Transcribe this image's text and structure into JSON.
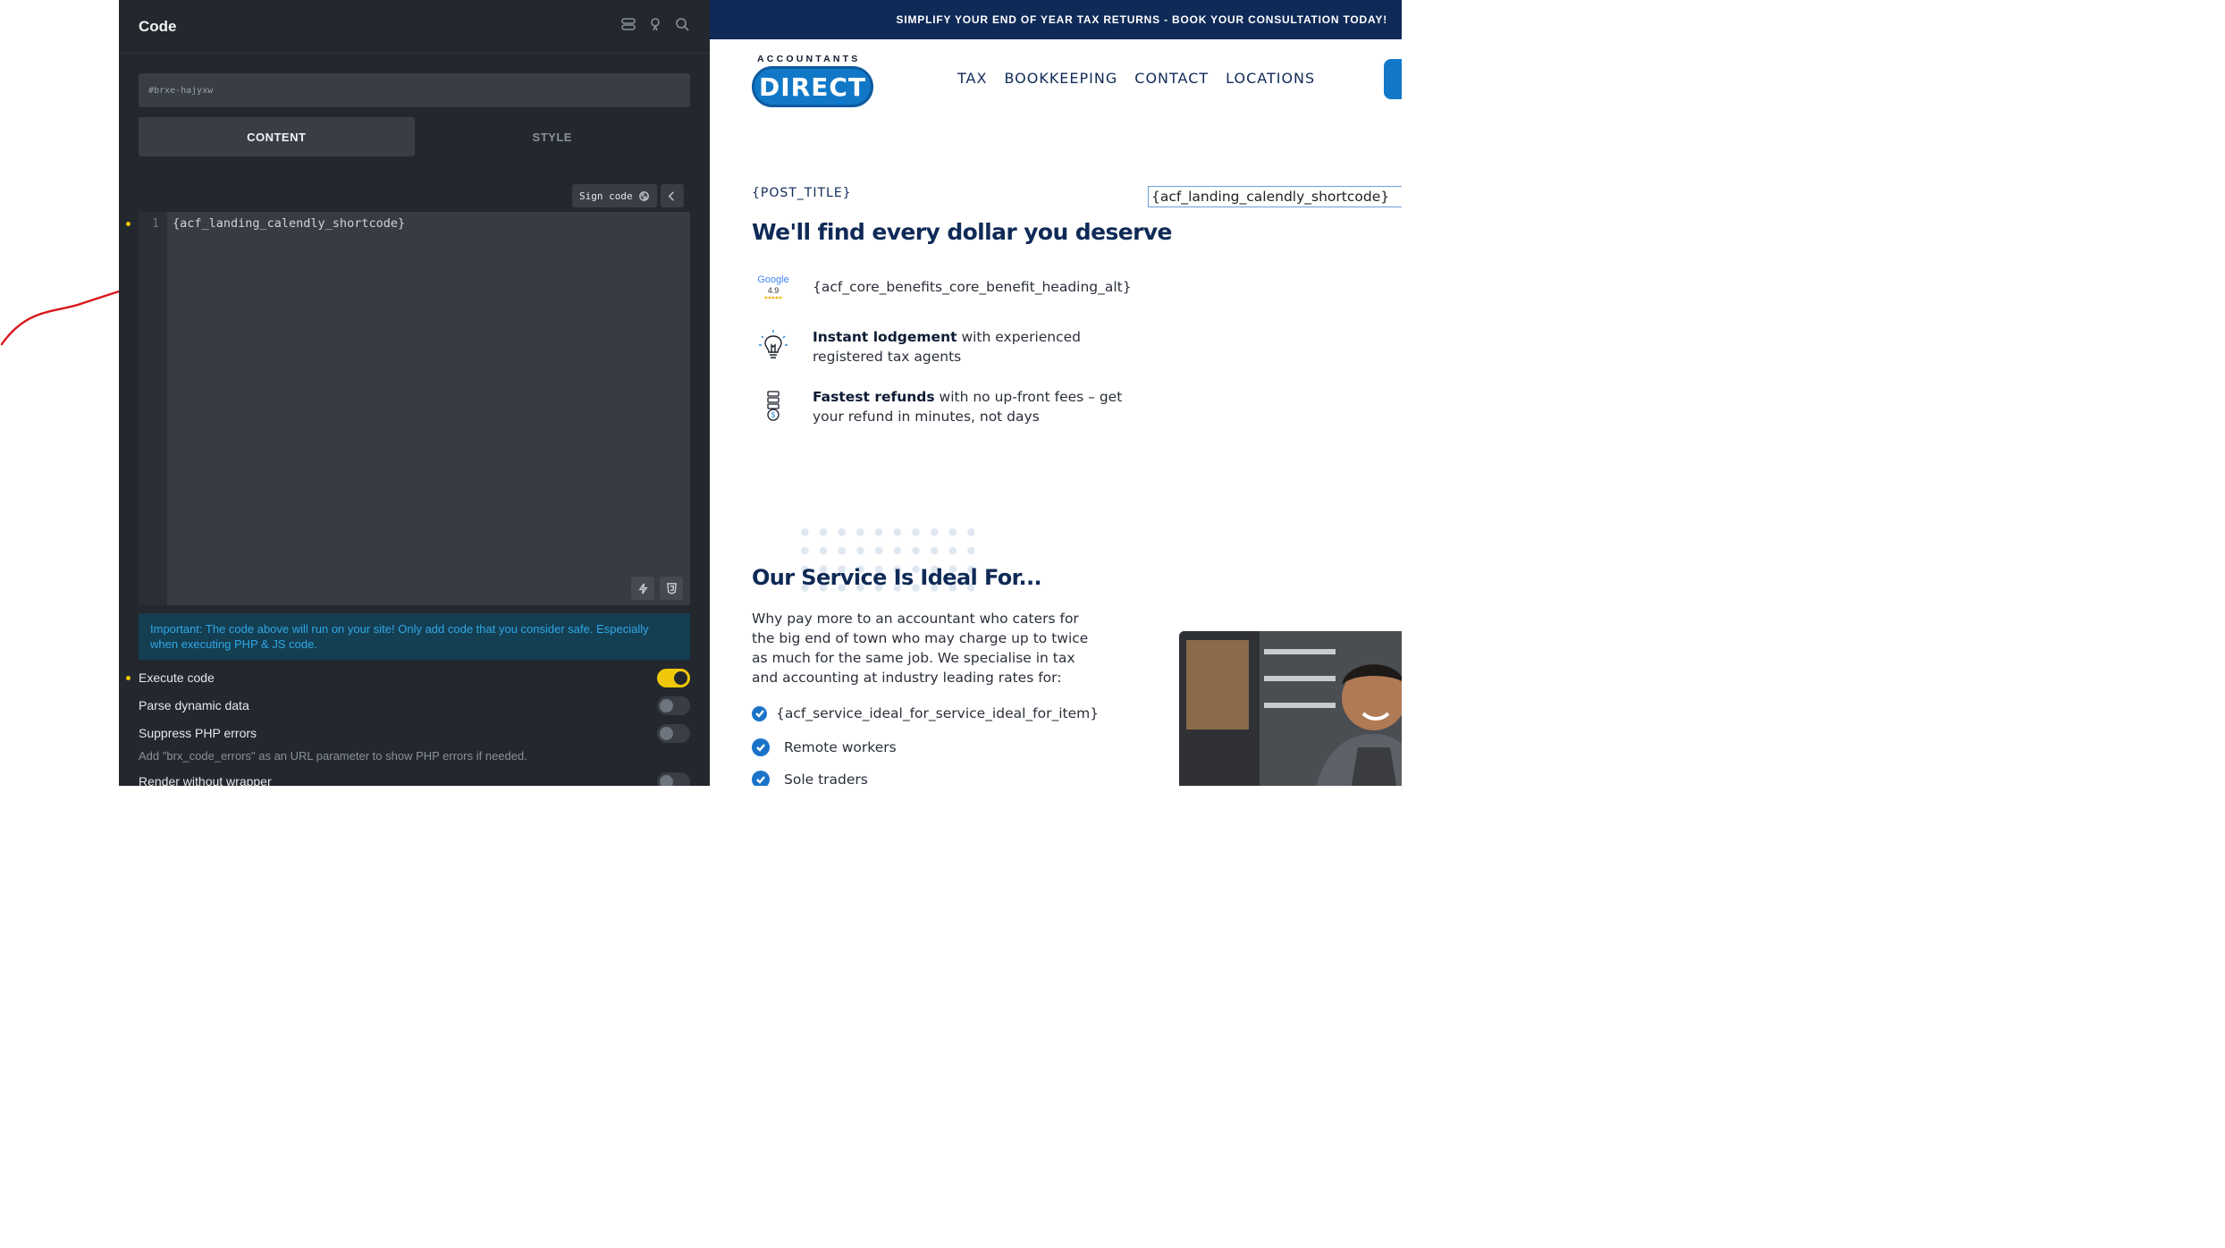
{
  "panel": {
    "title": "Code",
    "selector": "#brxe-hajyxw",
    "tabs": [
      "CONTENT",
      "STYLE"
    ],
    "sign_code_label": "Sign code",
    "line_number": "1",
    "code": "{acf_landing_calendly_shortcode}",
    "notice": "Important: The code above will run on your site! Only add code that you consider safe. Especially when executing PHP & JS code.",
    "controls": [
      {
        "label": "Execute code",
        "on": true
      },
      {
        "label": "Parse dynamic data",
        "on": false
      },
      {
        "label": "Suppress PHP errors",
        "on": false
      }
    ],
    "help_text": "Add \"brx_code_errors\" as an URL parameter to show PHP errors if needed.",
    "render_label": "Render without wrapper",
    "colors": {
      "accent": "#f0c808",
      "bg": "#23272e",
      "notice": "#2fa8e6"
    }
  },
  "site": {
    "banner": "SIMPLIFY YOUR END OF YEAR TAX RETURNS - BOOK YOUR CONSULTATION TODAY!",
    "logo_top": "ACCOUNTANTS",
    "logo_main": "DIRECT",
    "nav": [
      "TAX",
      "BOOKKEEPING",
      "CONTACT",
      "LOCATIONS"
    ],
    "post_title": "{POST_TITLE}",
    "heading": "We'll find every dollar you deserve",
    "calendly": "{acf_landing_calendly_shortcode}",
    "google_badge": {
      "name": "Google",
      "rating": "4.9"
    },
    "benefits": [
      {
        "bold": "",
        "text": "{acf_core_benefits_core_benefit_heading_alt}",
        "icon": "google-rating-icon"
      },
      {
        "bold": "Instant lodgement",
        "text": " with experienced registered tax agents",
        "icon": "lightbulb-icon"
      },
      {
        "bold": "Fastest refunds",
        "text": " with no up-front fees – get your refund in minutes, not days",
        "icon": "refund-icon"
      }
    ],
    "service_heading": "Our Service Is Ideal For...",
    "service_paragraph": "Why pay more to an accountant who caters for the big end of town who may charge up to twice as much for the same job. We specialise in tax and accounting at industry leading rates for:",
    "ideal_for": [
      "{acf_service_ideal_for_service_ideal_for_item}",
      "Remote workers",
      "Sole traders"
    ],
    "colors": {
      "navy": "#0f2a57",
      "blue": "#1178c8"
    }
  }
}
